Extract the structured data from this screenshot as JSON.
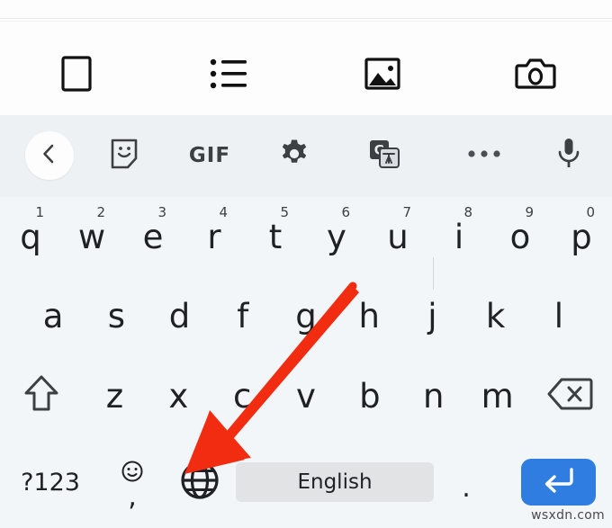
{
  "app": {
    "toolbar_icons": [
      {
        "name": "document-icon",
        "label": "Document"
      },
      {
        "name": "list-icon",
        "label": "List"
      },
      {
        "name": "image-icon",
        "label": "Image"
      },
      {
        "name": "camera-icon",
        "label": "Camera"
      }
    ]
  },
  "keyboard": {
    "toolbar": {
      "back_label": "Back",
      "sticker_label": "Stickers",
      "gif_label": "GIF",
      "settings_label": "Settings",
      "translate_label": "Translate",
      "more_label": "More options",
      "mic_label": "Voice input"
    },
    "rows": {
      "row1": [
        {
          "letter": "q",
          "sup": "1"
        },
        {
          "letter": "w",
          "sup": "2"
        },
        {
          "letter": "e",
          "sup": "3"
        },
        {
          "letter": "r",
          "sup": "4"
        },
        {
          "letter": "t",
          "sup": "5"
        },
        {
          "letter": "y",
          "sup": "6"
        },
        {
          "letter": "u",
          "sup": "7"
        },
        {
          "letter": "i",
          "sup": "8"
        },
        {
          "letter": "o",
          "sup": "9"
        },
        {
          "letter": "p",
          "sup": "0"
        }
      ],
      "row2": [
        {
          "letter": "a"
        },
        {
          "letter": "s"
        },
        {
          "letter": "d"
        },
        {
          "letter": "f"
        },
        {
          "letter": "g"
        },
        {
          "letter": "h"
        },
        {
          "letter": "j"
        },
        {
          "letter": "k"
        },
        {
          "letter": "l"
        }
      ],
      "row3": [
        {
          "letter": "z"
        },
        {
          "letter": "x"
        },
        {
          "letter": "c"
        },
        {
          "letter": "v"
        },
        {
          "letter": "b"
        },
        {
          "letter": "n"
        },
        {
          "letter": "m"
        }
      ],
      "row4": {
        "symbols_label": "?123",
        "comma_label": ",",
        "language_label": "Language switch",
        "spacebar_label": "English",
        "period_label": ".",
        "enter_label": "Enter"
      },
      "shift_label": "Shift",
      "backspace_label": "Backspace"
    }
  },
  "annotation": {
    "arrow_color": "#F22C11",
    "arrow_target": "language-globe-key"
  },
  "watermark": {
    "text": "wsxdn.com"
  },
  "colors": {
    "app_background": "#fdfdfd",
    "keyboard_background": "#f3f6f8",
    "keyboard_toolbar_background": "#eef1f4",
    "key_text": "#202124",
    "spacebar_background": "#e2e3e5",
    "enter_background": "#2f7de1",
    "accent_red": "#F22C11"
  }
}
